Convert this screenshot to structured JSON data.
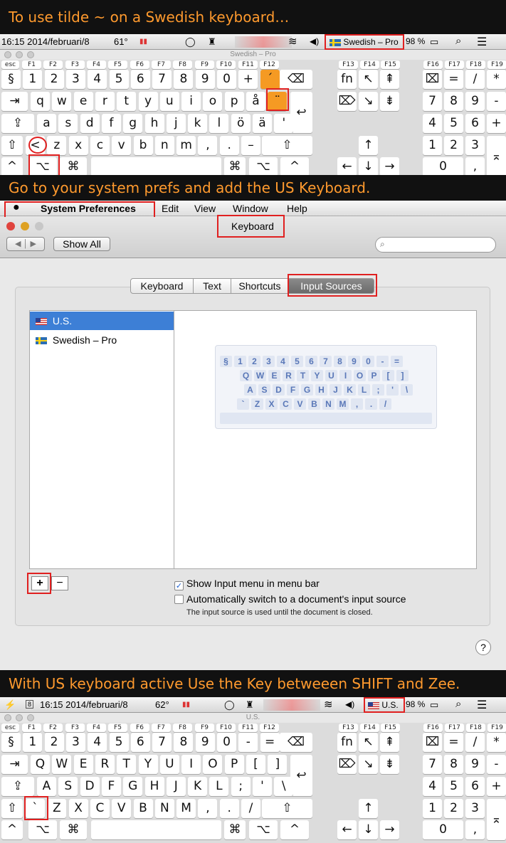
{
  "captions": {
    "one": "To use tilde ~ on a Swedish keyboard…",
    "two": "Go to your system prefs and add the US Keyboard.",
    "three": "With US keyboard active Use the Key betweeen SHIFT and Zee."
  },
  "top_keyboard": {
    "menubar": {
      "time": "16:15 2014/februari/8",
      "temp": "61°",
      "input_source": "Swedish – Pro",
      "battery": "98 %"
    },
    "title": "Swedish – Pro",
    "fkeys": [
      "esc",
      "F1",
      "F2",
      "F3",
      "F4",
      "F5",
      "F6",
      "F7",
      "F8",
      "F9",
      "F10",
      "F11",
      "F12",
      "F13",
      "F14",
      "F15",
      "F16",
      "F17",
      "F18",
      "F19"
    ],
    "row1": [
      "§",
      "1",
      "2",
      "3",
      "4",
      "5",
      "6",
      "7",
      "8",
      "9",
      "0",
      "+",
      "´",
      "⌫"
    ],
    "row2": [
      "⇥",
      "q",
      "w",
      "e",
      "r",
      "t",
      "y",
      "u",
      "i",
      "o",
      "p",
      "å",
      "¨",
      "↩"
    ],
    "row3": [
      "⇪",
      "a",
      "s",
      "d",
      "f",
      "g",
      "h",
      "j",
      "k",
      "l",
      "ö",
      "ä",
      "'"
    ],
    "row4": [
      "⇧",
      "<",
      "z",
      "x",
      "c",
      "v",
      "b",
      "n",
      "m",
      ",",
      ".",
      "–",
      "⇧"
    ],
    "row5": [
      "^",
      "⌥",
      "⌘",
      "⌘",
      "⌥",
      "^"
    ]
  },
  "bottom_keyboard": {
    "menubar": {
      "time": "16:15 2014/februari/8",
      "calendar_day": "8",
      "temp": "62°",
      "input_source": "U.S.",
      "battery": "98 %"
    },
    "title": "U.S.",
    "row1": [
      "§",
      "1",
      "2",
      "3",
      "4",
      "5",
      "6",
      "7",
      "8",
      "9",
      "0",
      "-",
      "=",
      "⌫"
    ],
    "row2": [
      "⇥",
      "Q",
      "W",
      "E",
      "R",
      "T",
      "Y",
      "U",
      "I",
      "O",
      "P",
      "[",
      "]",
      "↩"
    ],
    "row3": [
      "⇪",
      "A",
      "S",
      "D",
      "F",
      "G",
      "H",
      "J",
      "K",
      "L",
      ";",
      "'",
      "\\"
    ],
    "row4": [
      "⇧",
      "`",
      "Z",
      "X",
      "C",
      "V",
      "B",
      "N",
      "M",
      ",",
      ".",
      "/",
      "⇧"
    ],
    "row5": [
      "^",
      "⌥",
      "⌘",
      "⌘",
      "⌥",
      "^"
    ]
  },
  "nav_keys": {
    "fn": "fn",
    "del": "⌦",
    "top": [
      "↖",
      "⇞"
    ],
    "mid": [
      "↘",
      "⇟"
    ],
    "up": "↑",
    "bottom": [
      "←",
      "↓",
      "→"
    ]
  },
  "numpad": {
    "r1": [
      "⌧",
      "=",
      "/",
      "*"
    ],
    "r2": [
      "7",
      "8",
      "9",
      "-"
    ],
    "r3": [
      "4",
      "5",
      "6",
      "+"
    ],
    "r4": [
      "1",
      "2",
      "3"
    ],
    "r5": [
      "0",
      ","
    ],
    "enter": "⌅"
  },
  "prefs": {
    "menu": [
      "System Preferences",
      "Edit",
      "View",
      "Window",
      "Help"
    ],
    "window_title": "Keyboard",
    "show_all": "Show All",
    "search_placeholder": "",
    "tabs": [
      "Keyboard",
      "Text",
      "Shortcuts",
      "Input Sources"
    ],
    "sources": [
      "U.S.",
      "Swedish – Pro"
    ],
    "preview_rows": [
      [
        "§",
        "1",
        "2",
        "3",
        "4",
        "5",
        "6",
        "7",
        "8",
        "9",
        "0",
        "-",
        "="
      ],
      [
        "Q",
        "W",
        "E",
        "R",
        "T",
        "Y",
        "U",
        "I",
        "O",
        "P",
        "[",
        "]"
      ],
      [
        "A",
        "S",
        "D",
        "F",
        "G",
        "H",
        "J",
        "K",
        "L",
        ";",
        "'",
        "\\"
      ],
      [
        "`",
        "Z",
        "X",
        "C",
        "V",
        "B",
        "N",
        "M",
        ",",
        ".",
        "/"
      ]
    ],
    "add": "+",
    "remove": "−",
    "check1": "Show Input menu in menu bar",
    "check2": "Automatically switch to a document's input source",
    "note": "The input source is used until the document is closed.",
    "help": "?"
  },
  "colors": {
    "caption": "#ff9a2e",
    "highlight": "#f59a23",
    "box": "#e02020",
    "selected": "#3d7fd6"
  }
}
